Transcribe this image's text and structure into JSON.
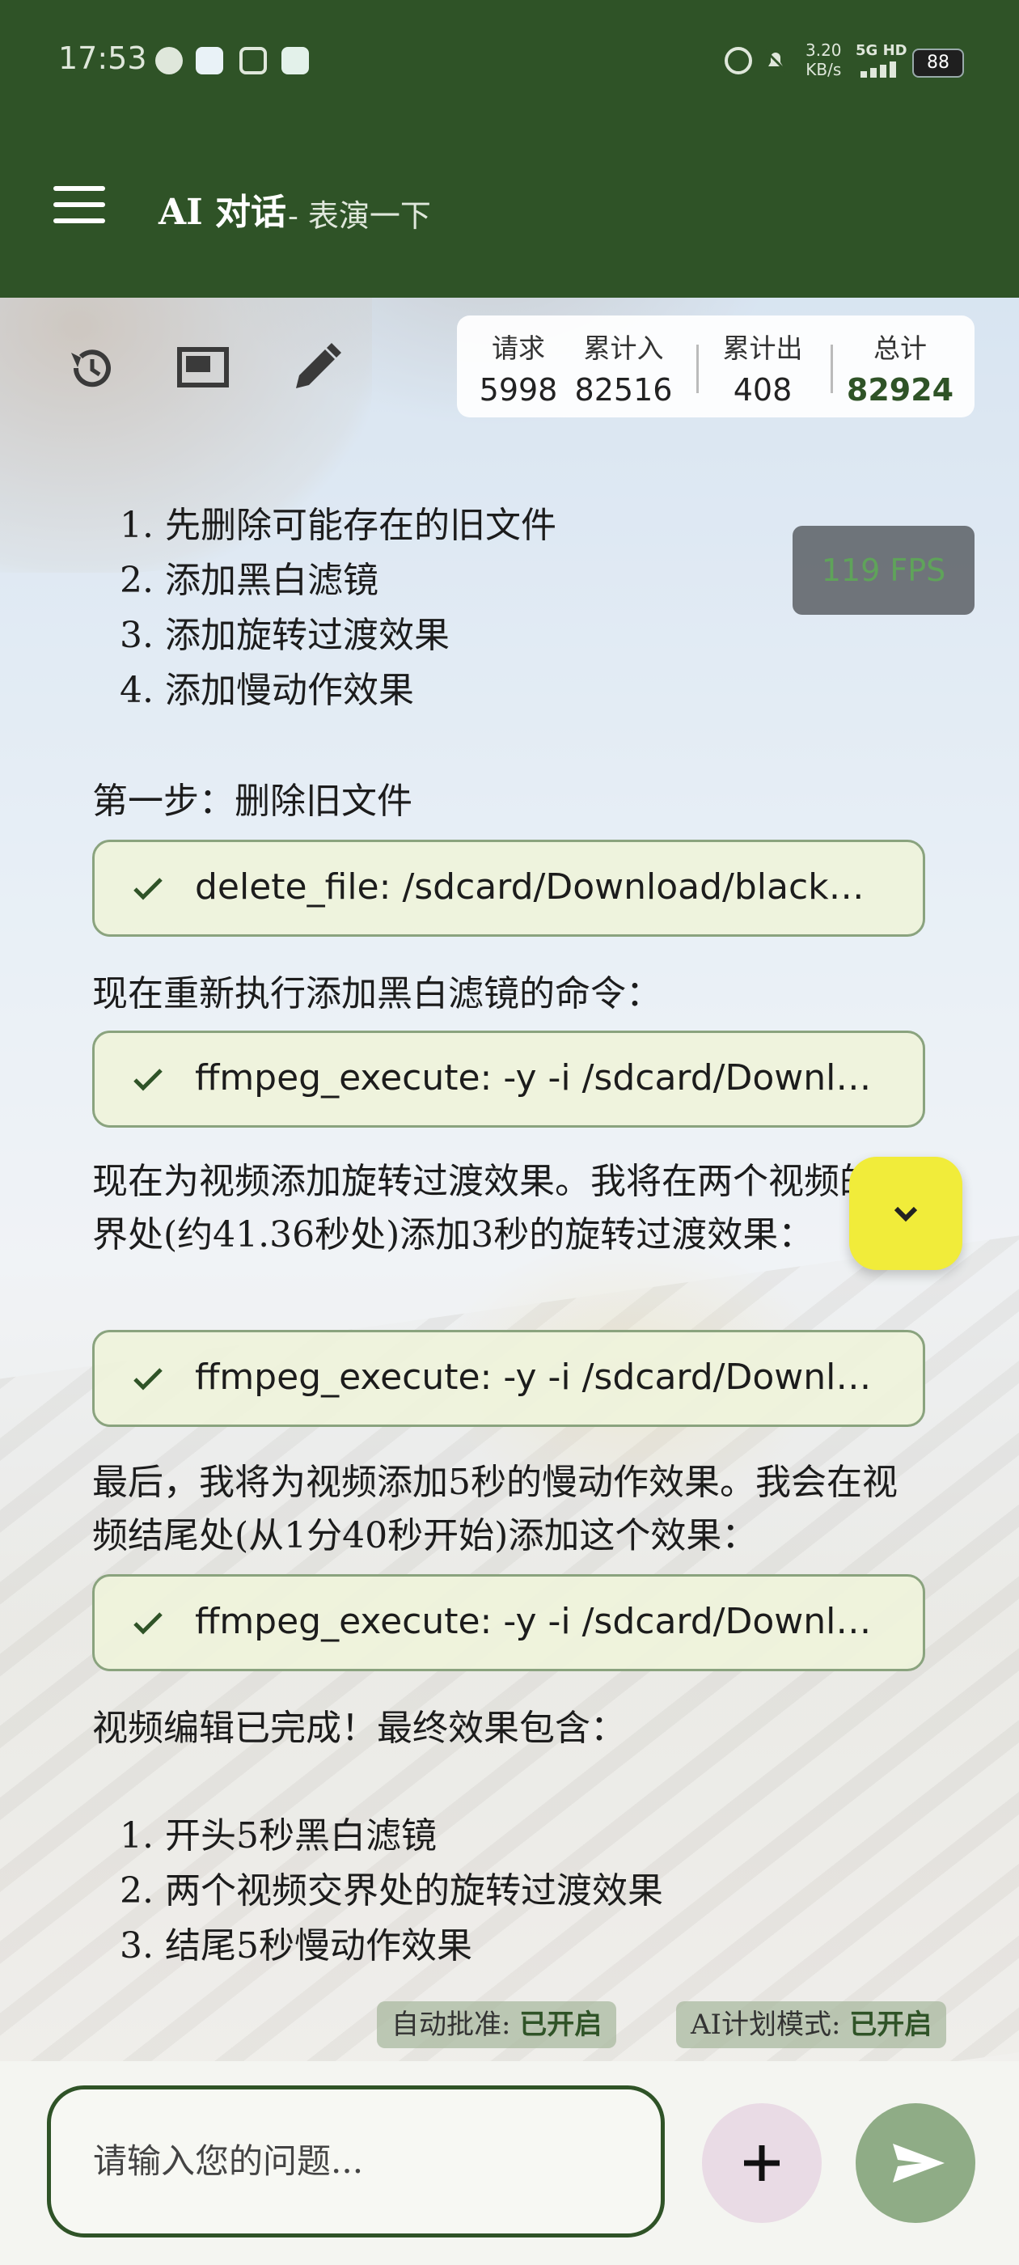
{
  "status": {
    "time": "17:53",
    "net_speed": "3.20",
    "net_unit": "KB/s",
    "net_type": "5G HD",
    "battery": "88"
  },
  "appbar": {
    "title": "AI 对话",
    "subtitle": "- 表演一下"
  },
  "stats": {
    "requests": {
      "label": "请求",
      "value": "5998"
    },
    "total_in": {
      "label": "累计入",
      "value": "82516"
    },
    "total_out": {
      "label": "累计出",
      "value": "408"
    },
    "total": {
      "label": "总计",
      "value": "82924"
    }
  },
  "fps": "119 FPS",
  "chat": {
    "plan_steps": [
      "1. 先删除可能存在的旧文件",
      "2. 添加黑白滤镜",
      "3. 添加旋转过渡效果",
      "4. 添加慢动作效果"
    ],
    "step1": "第一步：删除旧文件",
    "tool1": "delete_file: /sdcard/Download/black…",
    "para2": "现在重新执行添加黑白滤镜的命令：",
    "tool2": "ffmpeg_execute: -y -i /sdcard/Downl…",
    "para3": "现在为视频添加旋转过渡效果。我将在两个视频的交界处(约41.36秒处)添加3秒的旋转过渡效果：",
    "tool3": "ffmpeg_execute: -y -i /sdcard/Downl…",
    "para4": "最后，我将为视频添加5秒的慢动作效果。我会在视频结尾处(从1分40秒开始)添加这个效果：",
    "tool4": "ffmpeg_execute: -y -i /sdcard/Downl…",
    "para5": "视频编辑已完成！最终效果包含：",
    "result_items": [
      "1. 开头5秒黑白滤镜",
      "2. 两个视频交界处的旋转过渡效果",
      "3. 结尾5秒慢动作效果"
    ]
  },
  "pills": {
    "auto_approve_label": "自动批准: ",
    "auto_approve_value": "已开启",
    "plan_mode_label": "AI计划模式: ",
    "plan_mode_value": "已开启"
  },
  "input": {
    "placeholder": "请输入您的问题..."
  },
  "colors": {
    "primary": "#2f5327",
    "tool_card_bg": "#eef3dc",
    "fab_yellow": "#f1ec3a",
    "send_button": "#8fac86"
  }
}
